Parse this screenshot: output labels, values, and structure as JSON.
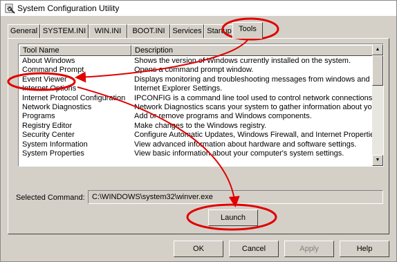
{
  "window": {
    "title": "System Configuration Utility"
  },
  "tabs": [
    {
      "label": "General"
    },
    {
      "label": "SYSTEM.INI"
    },
    {
      "label": "WIN.INI"
    },
    {
      "label": "BOOT.INI"
    },
    {
      "label": "Services"
    },
    {
      "label": "Startup"
    },
    {
      "label": "Tools",
      "active": true
    }
  ],
  "list": {
    "columns": [
      "Tool Name",
      "Description"
    ],
    "rows": [
      {
        "name": "About Windows",
        "desc": "Shows the version of Windows currently installed on the system."
      },
      {
        "name": "Command Prompt",
        "desc": "Opens a command prompt window."
      },
      {
        "name": "Event Viewer",
        "desc": "Displays monitoring and troubleshooting messages from windows and oth"
      },
      {
        "name": "Internet Options",
        "desc": "Internet Explorer Settings."
      },
      {
        "name": "Internet Protocol Configuration",
        "desc": "IPCONFIG is a command line tool used to control network connections or"
      },
      {
        "name": "Network Diagnostics",
        "desc": "Network Diagnostics scans your system to gather information about you"
      },
      {
        "name": "Programs",
        "desc": "Add or remove programs and Windows components."
      },
      {
        "name": "Registry Editor",
        "desc": "Make changes to the Windows registry."
      },
      {
        "name": "Security Center",
        "desc": "Configure Automatic Updates, Windows Firewall, and Internet Properties"
      },
      {
        "name": "System Information",
        "desc": "View advanced information about hardware and software settings."
      },
      {
        "name": "System Properties",
        "desc": "View basic information about your computer's system settings."
      }
    ]
  },
  "selected_command": {
    "label": "Selected Command:",
    "value": "C:\\WINDOWS\\system32\\winver.exe"
  },
  "buttons": {
    "launch": "Launch",
    "ok": "OK",
    "cancel": "Cancel",
    "apply": "Apply",
    "help": "Help"
  },
  "annotation_color": "#e00000"
}
